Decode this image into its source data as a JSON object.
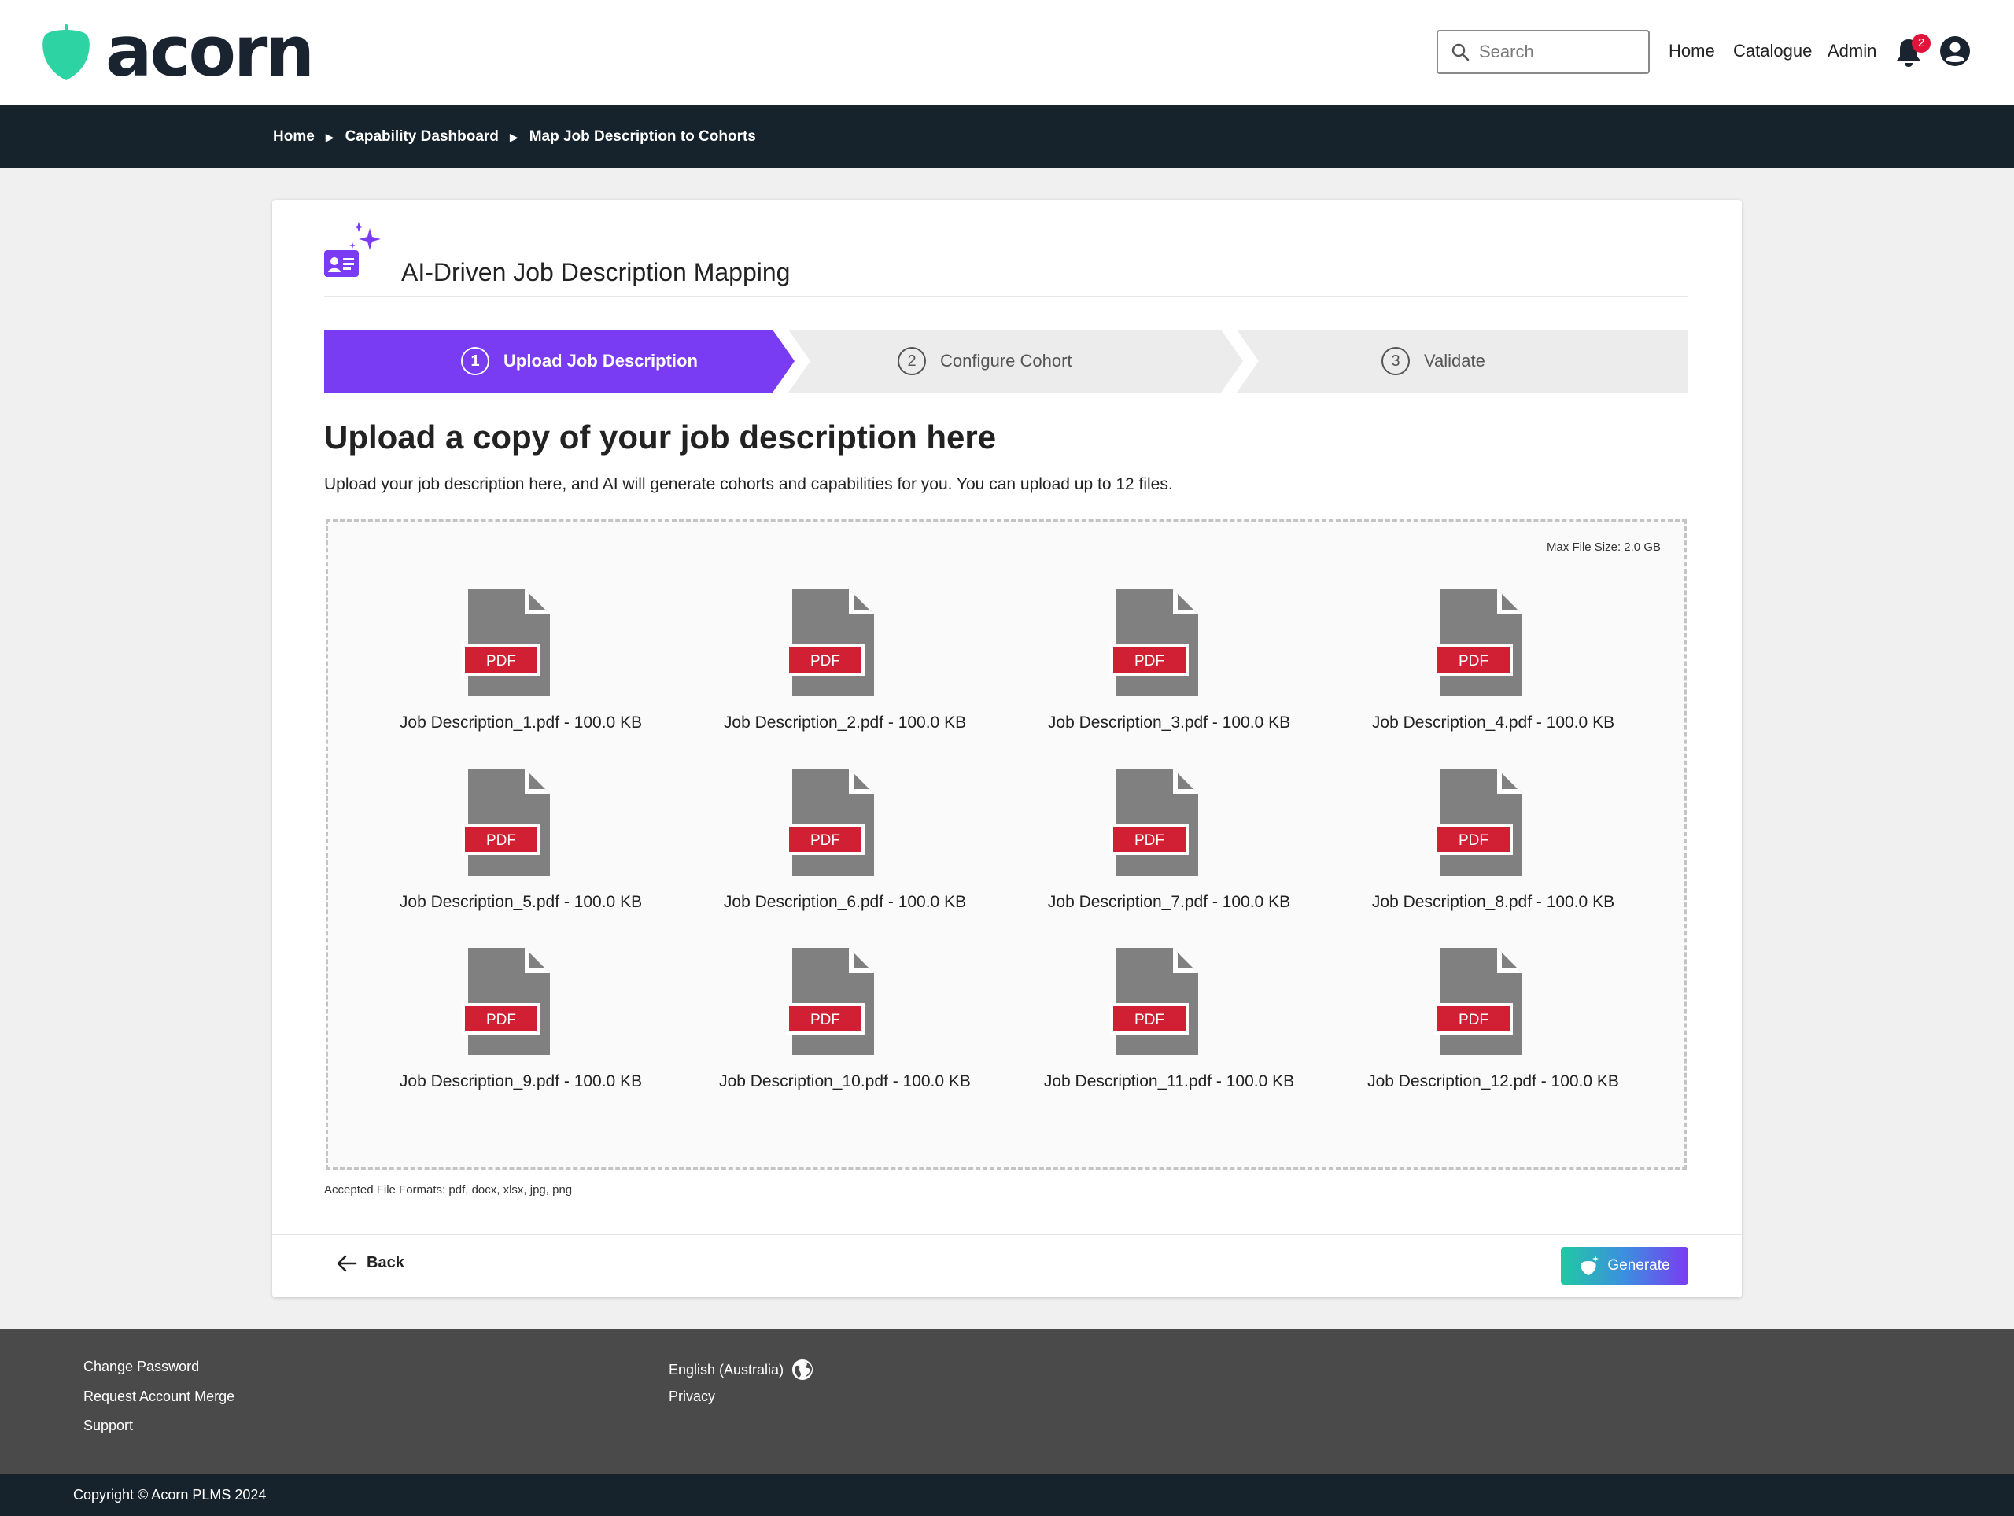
{
  "header": {
    "brand": "acorn",
    "search_placeholder": "Search",
    "nav": [
      "Home",
      "Catalogue",
      "Admin"
    ],
    "notification_count": "2"
  },
  "breadcrumb": [
    "Home",
    "Capability Dashboard",
    "Map Job Description to Cohorts"
  ],
  "card": {
    "title": "AI-Driven Job Description Mapping",
    "steps": [
      {
        "num": "1",
        "label": "Upload Job Description",
        "active": true
      },
      {
        "num": "2",
        "label": "Configure Cohort",
        "active": false
      },
      {
        "num": "3",
        "label": "Validate",
        "active": false
      }
    ],
    "heading": "Upload a copy of your job description here",
    "subtext": "Upload your job description here, and AI will generate cohorts and capabilities for you. You can upload up to 12 files.",
    "max_file_size": "Max File Size: 2.0 GB",
    "file_type_label": "PDF",
    "files": [
      "Job Description_1.pdf - 100.0 KB",
      "Job Description_2.pdf - 100.0 KB",
      "Job Description_3.pdf - 100.0 KB",
      "Job Description_4.pdf - 100.0 KB",
      "Job Description_5.pdf - 100.0 KB",
      "Job Description_6.pdf - 100.0 KB",
      "Job Description_7.pdf - 100.0 KB",
      "Job Description_8.pdf - 100.0 KB",
      "Job Description_9.pdf - 100.0 KB",
      "Job Description_10.pdf - 100.0 KB",
      "Job Description_11.pdf - 100.0 KB",
      "Job Description_12.pdf - 100.0 KB"
    ],
    "accepted_formats": "Accepted File Formats: pdf, docx, xlsx, jpg, png",
    "back_label": "Back",
    "generate_label": "Generate"
  },
  "footer": {
    "links_left": [
      "Change Password",
      "Request Account Merge",
      "Support"
    ],
    "language": "English (Australia)",
    "privacy": "Privacy",
    "copyright": "Copyright © Acorn PLMS 2024"
  },
  "colors": {
    "accent": "#7a3cf2",
    "brand": "#2ed3a4",
    "dark": "#17232c",
    "pdf_red": "#d11f34",
    "file_gray": "#808080"
  }
}
